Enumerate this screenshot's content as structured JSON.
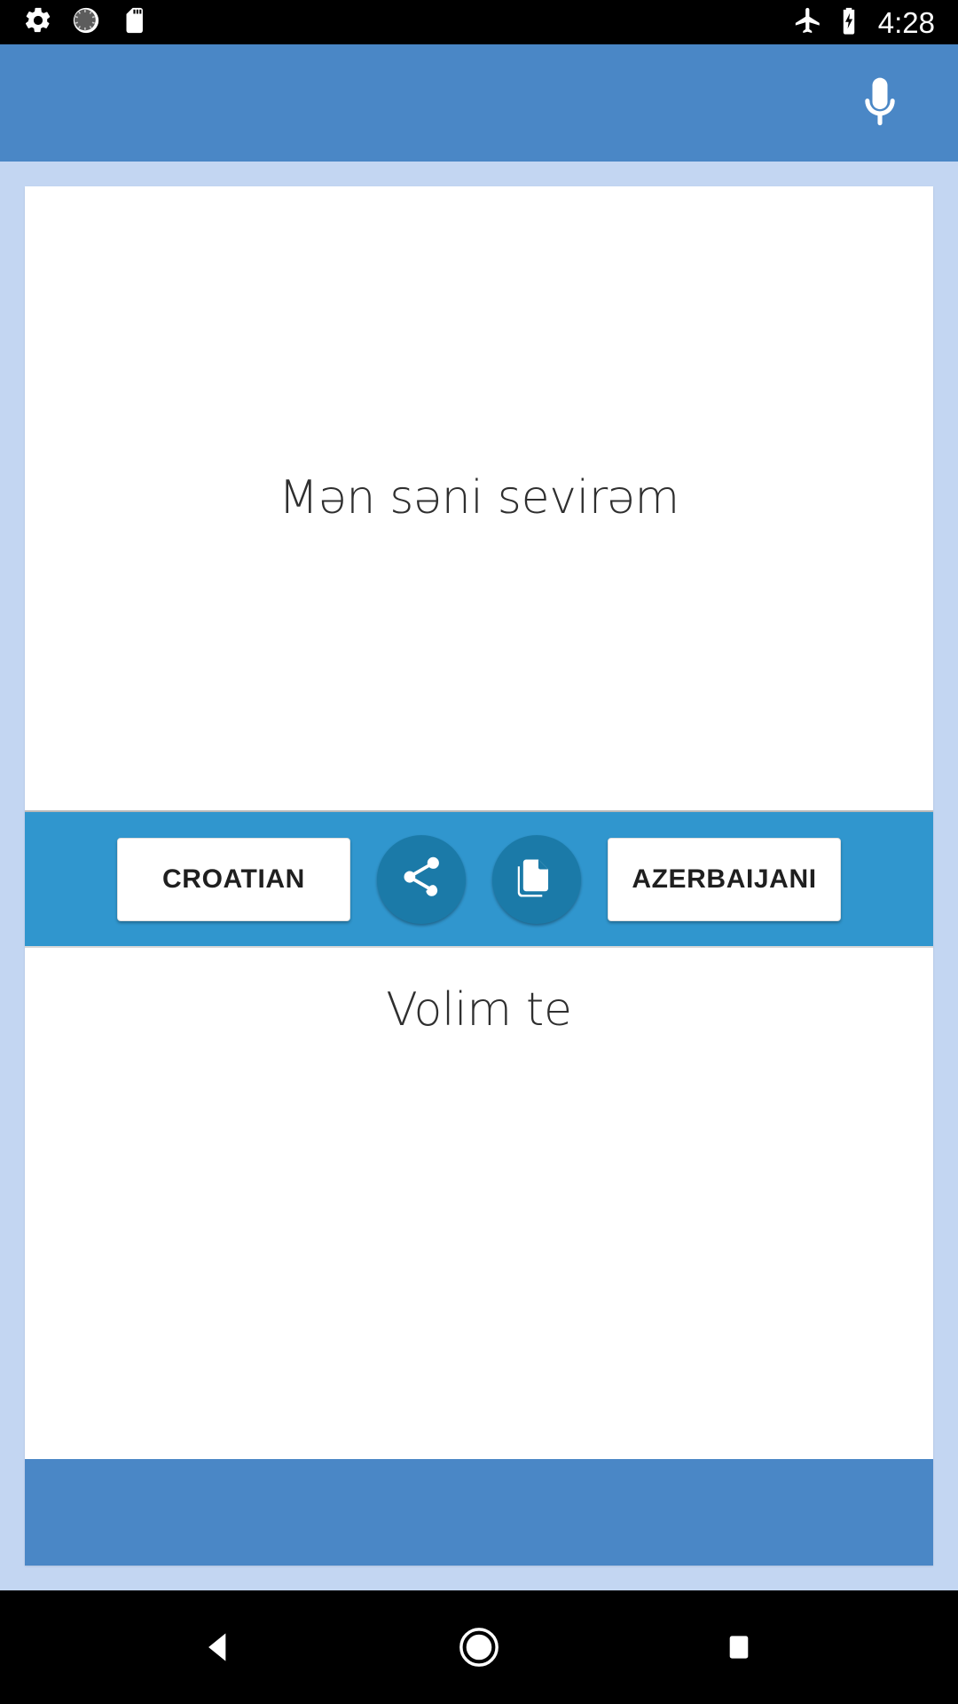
{
  "status_bar": {
    "left_icons": [
      {
        "name": "settings-gear-icon"
      },
      {
        "name": "sync-spinner-icon"
      },
      {
        "name": "sd-card-icon"
      }
    ],
    "right_icons": [
      {
        "name": "airplane-mode-icon"
      },
      {
        "name": "battery-charging-icon"
      }
    ],
    "clock": "4:28"
  },
  "app_bar": {
    "background_color": "#4a87c6",
    "mic_button_label": "mic-icon"
  },
  "translator": {
    "source_text": "Mən səni sevirəm",
    "target_text": "Volim te",
    "controls": {
      "bar_color": "#3096ce",
      "source_language_button": "CROATIAN",
      "target_language_button": "AZERBAIJANI",
      "share_button_label": "share-icon",
      "copy_button_label": "copy-icon",
      "round_button_color": "#1b7aa8"
    }
  },
  "nav_bar": {
    "back_label": "back-nav-button",
    "home_label": "home-nav-button",
    "recents_label": "recents-nav-button"
  }
}
